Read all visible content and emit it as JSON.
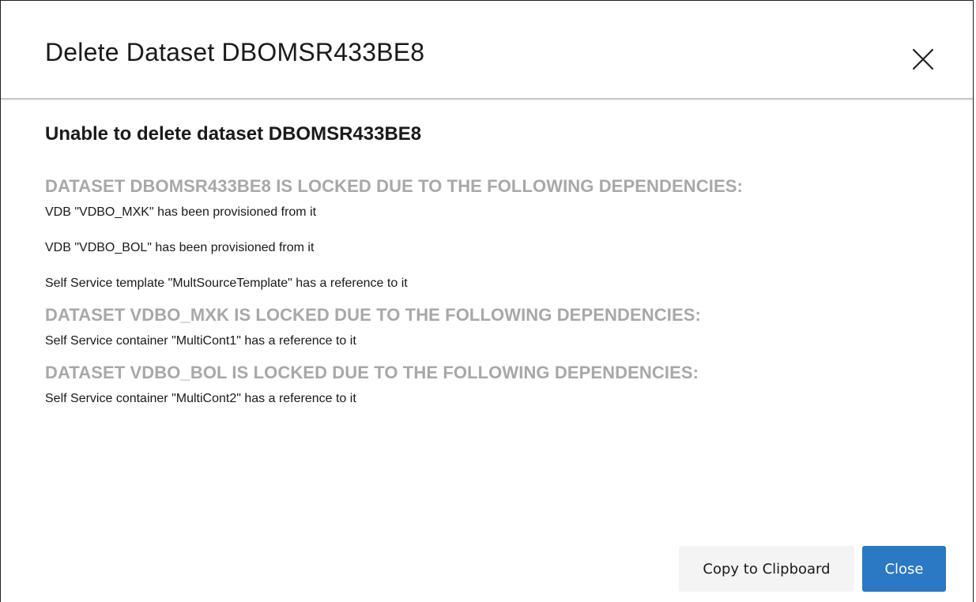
{
  "dialog": {
    "title": "Delete Dataset DBOMSR433BE8",
    "heading": "Unable to delete dataset DBOMSR433BE8",
    "sections": [
      {
        "title": "DATASET DBOMSR433BE8 IS LOCKED DUE TO THE FOLLOWING DEPENDENCIES:",
        "items": [
          "VDB \"VDBO_MXK\" has been provisioned from it",
          "VDB \"VDBO_BOL\" has been provisioned from it",
          "Self Service template \"MultSourceTemplate\" has a reference to it"
        ]
      },
      {
        "title": "DATASET VDBO_MXK IS LOCKED DUE TO THE FOLLOWING DEPENDENCIES:",
        "items": [
          "Self Service container \"MultiCont1\" has a reference to it"
        ]
      },
      {
        "title": "DATASET VDBO_BOL IS LOCKED DUE TO THE FOLLOWING DEPENDENCIES:",
        "items": [
          "Self Service container \"MultiCont2\" has a reference to it"
        ]
      }
    ],
    "buttons": {
      "copy_label": "Copy to Clipboard",
      "close_label": "Close"
    },
    "colors": {
      "primary": "#2b78c5",
      "section_title": "#a8a8a8",
      "secondary_button_bg": "#f4f4f4"
    },
    "icons": {
      "close": "close-icon"
    }
  }
}
